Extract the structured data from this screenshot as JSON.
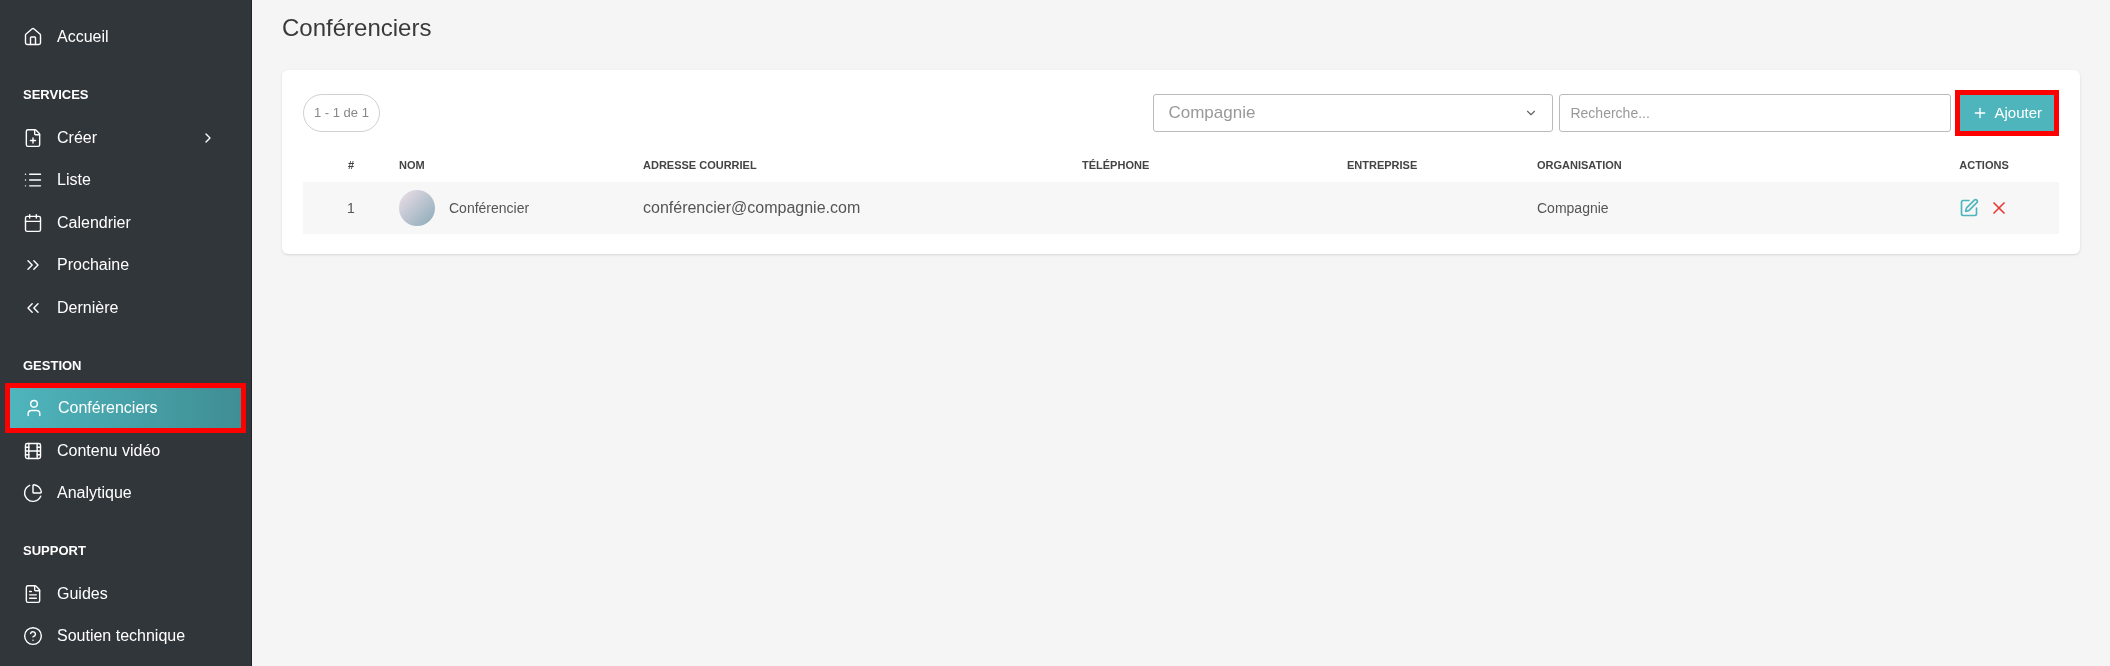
{
  "sidebar": {
    "top_items": [
      {
        "label": "Accueil",
        "selected": false,
        "highlighted": false,
        "expandable": false
      }
    ],
    "sections": [
      {
        "title": "SERVICES",
        "items": [
          {
            "label": "Créer",
            "selected": false,
            "highlighted": false,
            "expandable": true
          },
          {
            "label": "Liste",
            "selected": false,
            "highlighted": false,
            "expandable": false
          },
          {
            "label": "Calendrier",
            "selected": false,
            "highlighted": false,
            "expandable": false
          },
          {
            "label": "Prochaine",
            "selected": false,
            "highlighted": false,
            "expandable": false
          },
          {
            "label": "Dernière",
            "selected": false,
            "highlighted": false,
            "expandable": false
          }
        ]
      },
      {
        "title": "GESTION",
        "items": [
          {
            "label": "Conférenciers",
            "selected": true,
            "highlighted": true,
            "expandable": false
          },
          {
            "label": "Contenu vidéo",
            "selected": false,
            "highlighted": false,
            "expandable": false
          },
          {
            "label": "Analytique",
            "selected": false,
            "highlighted": false,
            "expandable": false
          }
        ]
      },
      {
        "title": "SUPPORT",
        "items": [
          {
            "label": "Guides",
            "selected": false,
            "highlighted": false,
            "expandable": false
          },
          {
            "label": "Soutien technique",
            "selected": false,
            "highlighted": false,
            "expandable": false
          }
        ]
      }
    ]
  },
  "page_title": "Conférenciers",
  "toolbar": {
    "pager": "1 - 1 de 1",
    "company_select": {
      "value": "Compagnie"
    },
    "search": {
      "placeholder": "Recherche..."
    },
    "add_button": {
      "label": "Ajouter",
      "highlighted": true
    }
  },
  "table": {
    "columns": [
      "#",
      "NOM",
      "ADRESSE COURRIEL",
      "TÉLÉPHONE",
      "ENTREPRISE",
      "ORGANISATION",
      "ACTIONS"
    ],
    "rows": [
      {
        "number": "1",
        "name": "Conférencier",
        "email": "conférencier@compagnie.com",
        "organisation": "Compagnie"
      }
    ]
  }
}
